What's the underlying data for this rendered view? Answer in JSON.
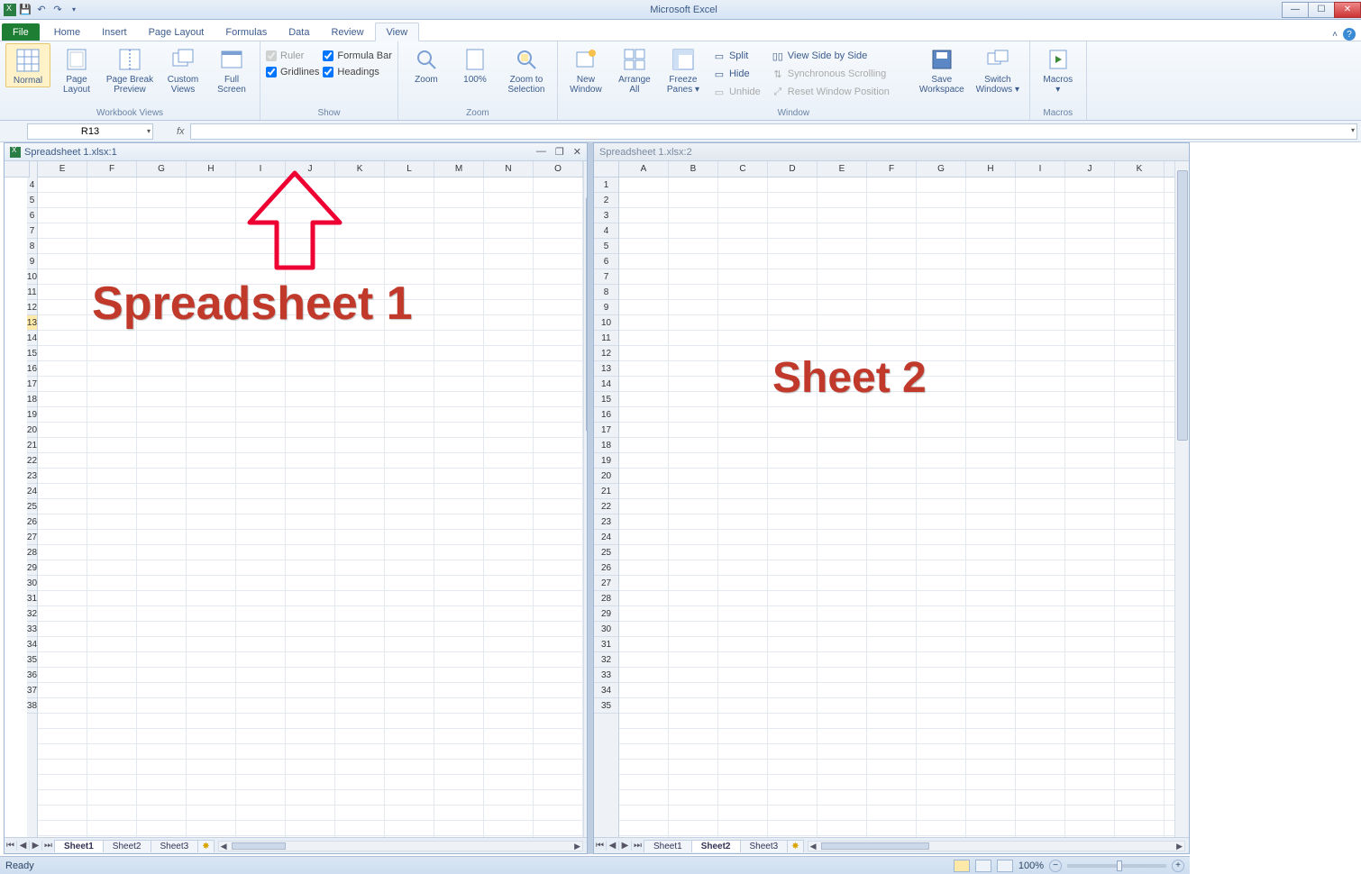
{
  "app": {
    "title": "Microsoft Excel"
  },
  "qat": {
    "save": "save",
    "undo": "undo",
    "redo": "redo"
  },
  "tabs": [
    "File",
    "Home",
    "Insert",
    "Page Layout",
    "Formulas",
    "Data",
    "Review",
    "View"
  ],
  "activeTab": "View",
  "ribbon": {
    "workbookViews": {
      "label": "Workbook Views",
      "normal": "Normal",
      "pageLayout": "Page\nLayout",
      "pageBreak": "Page Break\nPreview",
      "custom": "Custom\nViews",
      "full": "Full\nScreen"
    },
    "show": {
      "label": "Show",
      "ruler": "Ruler",
      "formulaBar": "Formula Bar",
      "gridlines": "Gridlines",
      "headings": "Headings"
    },
    "zoom": {
      "label": "Zoom",
      "zoom": "Zoom",
      "p100": "100%",
      "toSel": "Zoom to\nSelection"
    },
    "window": {
      "label": "Window",
      "newWin": "New\nWindow",
      "arrange": "Arrange\nAll",
      "freeze": "Freeze\nPanes ▾",
      "split": "Split",
      "hide": "Hide",
      "unhide": "Unhide",
      "sideBySide": "View Side by Side",
      "syncScroll": "Synchronous Scrolling",
      "resetPos": "Reset Window Position",
      "saveWs": "Save\nWorkspace",
      "switch": "Switch\nWindows ▾"
    },
    "macros": {
      "label": "Macros",
      "macros": "Macros\n▾"
    }
  },
  "nameBox": "R13",
  "fx": "fx",
  "panes": {
    "left": {
      "title": "Spreadsheet 1.xlsx:1",
      "cols": [
        "E",
        "F",
        "G",
        "H",
        "I",
        "J",
        "K",
        "L",
        "M",
        "N",
        "O"
      ],
      "rowStart": 4,
      "rowEnd": 38,
      "selectedRow": 13,
      "overlay": "Spreadsheet 1",
      "sheets": [
        "Sheet1",
        "Sheet2",
        "Sheet3"
      ],
      "activeSheet": "Sheet1"
    },
    "right": {
      "title": "Spreadsheet 1.xlsx:2",
      "cols": [
        "A",
        "B",
        "C",
        "D",
        "E",
        "F",
        "G",
        "H",
        "I",
        "J",
        "K"
      ],
      "rowStart": 1,
      "rowEnd": 35,
      "overlay": "Sheet 2",
      "sheets": [
        "Sheet1",
        "Sheet2",
        "Sheet3"
      ],
      "activeSheet": "Sheet2"
    }
  },
  "status": {
    "ready": "Ready",
    "zoom": "100%"
  }
}
